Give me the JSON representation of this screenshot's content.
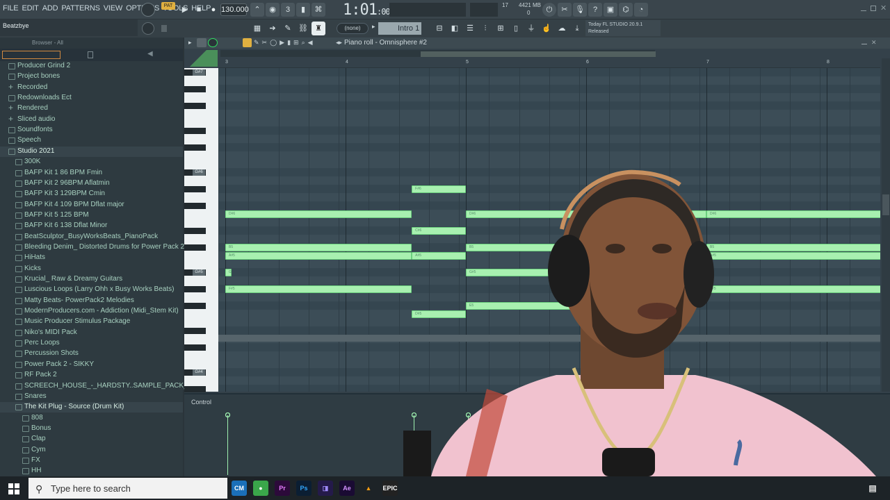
{
  "menu": [
    "FILE",
    "EDIT",
    "ADD",
    "PATTERNS",
    "VIEW",
    "OPTIONS",
    "TOOLS",
    "HELP"
  ],
  "toolbar": {
    "pat_label": "PAT",
    "tempo": "130.000",
    "time_main": "1:01",
    "time_sub": ":00",
    "cpu": "17",
    "memory": "4421 MB",
    "voices": "0"
  },
  "channel_name": "Beatzbye",
  "snap": "(none)",
  "pattern": "Intro 1",
  "news": {
    "line1": "Today  FL STUDIO 20.9.1",
    "line2": "Released"
  },
  "browser": {
    "header": "Browser - All",
    "items": [
      {
        "label": "Producer Grind 2",
        "indent": 0,
        "icon": "folder"
      },
      {
        "label": "Project bones",
        "indent": 0,
        "icon": "folder"
      },
      {
        "label": "Recorded",
        "indent": 0,
        "icon": "plus"
      },
      {
        "label": "Redownloads Ect",
        "indent": 0,
        "icon": "folder"
      },
      {
        "label": "Rendered",
        "indent": 0,
        "icon": "plus"
      },
      {
        "label": "Sliced audio",
        "indent": 0,
        "icon": "plus"
      },
      {
        "label": "Soundfonts",
        "indent": 0,
        "icon": "folder"
      },
      {
        "label": "Speech",
        "indent": 0,
        "icon": "folder"
      },
      {
        "label": "Studio 2021",
        "indent": 0,
        "icon": "folder",
        "open": true
      },
      {
        "label": "300K",
        "indent": 1,
        "icon": "folder"
      },
      {
        "label": "BAFP Kit 1 86 BPM Fmin",
        "indent": 1,
        "icon": "folder"
      },
      {
        "label": "BAFP Kit 2 96BPM Aflatmin",
        "indent": 1,
        "icon": "folder"
      },
      {
        "label": "BAFP Kit 3 129BPM Cmin",
        "indent": 1,
        "icon": "folder"
      },
      {
        "label": "BAFP Kit 4 109 BPM Dflat major",
        "indent": 1,
        "icon": "folder"
      },
      {
        "label": "BAFP Kit 5 125 BPM",
        "indent": 1,
        "icon": "folder"
      },
      {
        "label": "BAFP Kit 6 138 Dflat Minor",
        "indent": 1,
        "icon": "folder"
      },
      {
        "label": "BeatSculptor_BusyWorksBeats_PianoPack",
        "indent": 1,
        "icon": "folder"
      },
      {
        "label": "Bleeding Denim_ Distorted Drums for Power Pack 2",
        "indent": 1,
        "icon": "folder"
      },
      {
        "label": "HiHats",
        "indent": 1,
        "icon": "folder"
      },
      {
        "label": "Kicks",
        "indent": 1,
        "icon": "folder"
      },
      {
        "label": "Krucial_ Raw & Dreamy Guitars",
        "indent": 1,
        "icon": "folder"
      },
      {
        "label": "Luscious Loops (Larry Ohh x Busy Works Beats)",
        "indent": 1,
        "icon": "folder"
      },
      {
        "label": "Matty Beats- PowerPack2 Melodies",
        "indent": 1,
        "icon": "folder"
      },
      {
        "label": "ModernProducers.com - Addiction (Midi_Stem Kit)",
        "indent": 1,
        "icon": "folder"
      },
      {
        "label": "Music Producer Stimulus Package",
        "indent": 1,
        "icon": "folder"
      },
      {
        "label": "Niko's MIDI Pack",
        "indent": 1,
        "icon": "folder"
      },
      {
        "label": "Perc Loops",
        "indent": 1,
        "icon": "folder"
      },
      {
        "label": "Percussion Shots",
        "indent": 1,
        "icon": "folder"
      },
      {
        "label": "Power Pack 2 - SIKKY",
        "indent": 1,
        "icon": "folder"
      },
      {
        "label": "RF Pack 2",
        "indent": 1,
        "icon": "folder"
      },
      {
        "label": "SCREECH_HOUSE_-_HARDSTY..SAMPLE_PACK_FOR_MEMBERS",
        "indent": 1,
        "icon": "folder"
      },
      {
        "label": "Snares",
        "indent": 1,
        "icon": "folder"
      },
      {
        "label": "The Kit Plug - Source (Drum Kit)",
        "indent": 1,
        "icon": "folder",
        "open": true
      },
      {
        "label": "808",
        "indent": 2,
        "icon": "folder"
      },
      {
        "label": "Bonus",
        "indent": 2,
        "icon": "folder"
      },
      {
        "label": "Clap",
        "indent": 2,
        "icon": "folder"
      },
      {
        "label": "Cym",
        "indent": 2,
        "icon": "folder"
      },
      {
        "label": "FX",
        "indent": 2,
        "icon": "folder"
      },
      {
        "label": "HH",
        "indent": 2,
        "icon": "folder"
      }
    ]
  },
  "piano_roll": {
    "title": "Piano roll - Omnisphere #2",
    "bars": [
      "3",
      "4",
      "5",
      "6",
      "7",
      "8"
    ],
    "key_labels": [
      "G#7",
      "G#6",
      "G#5",
      "G#4"
    ],
    "control_label": "Control",
    "notes": [
      {
        "bar": 3.0,
        "len": 1.55,
        "row": 17,
        "label": "D#6"
      },
      {
        "bar": 4.55,
        "len": 0.45,
        "row": 14,
        "label": "F#6"
      },
      {
        "bar": 4.55,
        "len": 0.45,
        "row": 19,
        "label": "C#6"
      },
      {
        "bar": 3.0,
        "len": 1.55,
        "row": 21,
        "label": "B5"
      },
      {
        "bar": 3.0,
        "len": 1.55,
        "row": 22,
        "label": "A#5"
      },
      {
        "bar": 4.55,
        "len": 0.45,
        "row": 22,
        "label": "A#5"
      },
      {
        "bar": 3.0,
        "len": 0.05,
        "row": 24,
        "label": "G"
      },
      {
        "bar": 3.0,
        "len": 1.55,
        "row": 26,
        "label": "F#5"
      },
      {
        "bar": 4.55,
        "len": 0.45,
        "row": 29,
        "label": "D#5"
      },
      {
        "bar": 5.0,
        "len": 2.0,
        "row": 17,
        "label": "D#6"
      },
      {
        "bar": 5.0,
        "len": 1.0,
        "row": 21,
        "label": "B5"
      },
      {
        "bar": 5.0,
        "len": 0.8,
        "row": 24,
        "label": "G#5"
      },
      {
        "bar": 5.0,
        "len": 1.0,
        "row": 28,
        "label": "E5"
      },
      {
        "bar": 7.0,
        "len": 1.45,
        "row": 17,
        "label": "D#6"
      },
      {
        "bar": 7.0,
        "len": 1.45,
        "row": 21,
        "label": "B5"
      },
      {
        "bar": 7.0,
        "len": 1.45,
        "row": 22,
        "label": "A#5"
      },
      {
        "bar": 7.0,
        "len": 1.45,
        "row": 26,
        "label": "F#5"
      }
    ]
  },
  "taskbar": {
    "search_placeholder": "Type here to search",
    "apps": [
      "CM",
      "Chrome",
      "Pr",
      "Ps",
      "VS",
      "Ae",
      "VLC",
      "EPIC"
    ]
  },
  "colors": {
    "note": "#a8f0b0",
    "accent": "#e0b040",
    "grid": "#3c4d57"
  }
}
